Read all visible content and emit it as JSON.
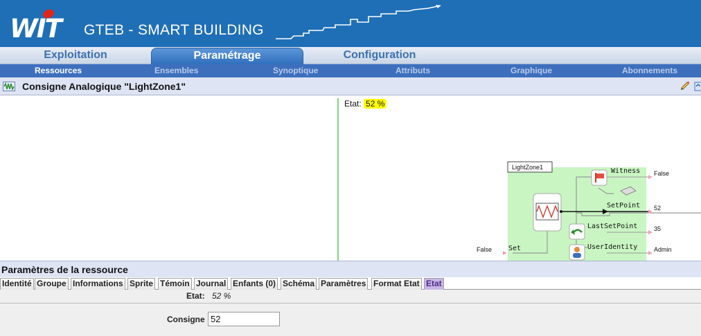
{
  "header": {
    "logo_text": "WIT",
    "app_title": "GTEB - SMART BUILDING"
  },
  "main_tabs": [
    {
      "label": "Exploitation",
      "active": false
    },
    {
      "label": "Paramétrage",
      "active": true
    },
    {
      "label": "Configuration",
      "active": false
    }
  ],
  "sub_nav": [
    {
      "label": "Ressources",
      "active": true
    },
    {
      "label": "Ensembles",
      "active": false
    },
    {
      "label": "Synoptique",
      "active": false
    },
    {
      "label": "Attributs",
      "active": false
    },
    {
      "label": "Graphique",
      "active": false
    },
    {
      "label": "Abonnements",
      "active": false
    }
  ],
  "page": {
    "title": "Consigne Analogique \"LightZone1\"",
    "title_icon": "waveform-icon",
    "edit_icon": "pencil-icon",
    "export_icon": "export-icon"
  },
  "etat": {
    "label": "Etat:",
    "value": "52 %"
  },
  "diagram": {
    "block_name": "LightZone1",
    "ports": [
      {
        "name": "Witness",
        "value": "False"
      },
      {
        "name": "SetPoint",
        "value": "52"
      },
      {
        "name": "LastSetPoint",
        "value": "35"
      },
      {
        "name": "UserIdentity",
        "value": "Admin"
      }
    ],
    "input": {
      "name": "Set",
      "value": "False"
    }
  },
  "section": {
    "title": "Paramètres de la ressource"
  },
  "resource_tabs": [
    {
      "label": "Identité",
      "active": false
    },
    {
      "label": "Groupe",
      "active": false
    },
    {
      "label": "Informations",
      "active": false
    },
    {
      "label": "Sprite",
      "active": false
    },
    {
      "label": "Témoin",
      "active": false
    },
    {
      "label": "Journal",
      "active": false
    },
    {
      "label": "Enfants (0)",
      "active": false
    },
    {
      "label": "Schéma",
      "active": false
    },
    {
      "label": "Paramètres",
      "active": false
    },
    {
      "label": "Format Etat",
      "active": false
    },
    {
      "label": "Etat",
      "active": true
    }
  ],
  "form": {
    "etat_label": "Etat:",
    "etat_value": "52 %",
    "consigne_label": "Consigne",
    "consigne_value": "52"
  },
  "colors": {
    "header_blue": "#1f6fb7",
    "subnav_blue": "#3d6fbd",
    "highlight_yellow": "#ffff00",
    "block_green": "#c9f5c2",
    "active_tab_purple": "#c9b6e6"
  }
}
